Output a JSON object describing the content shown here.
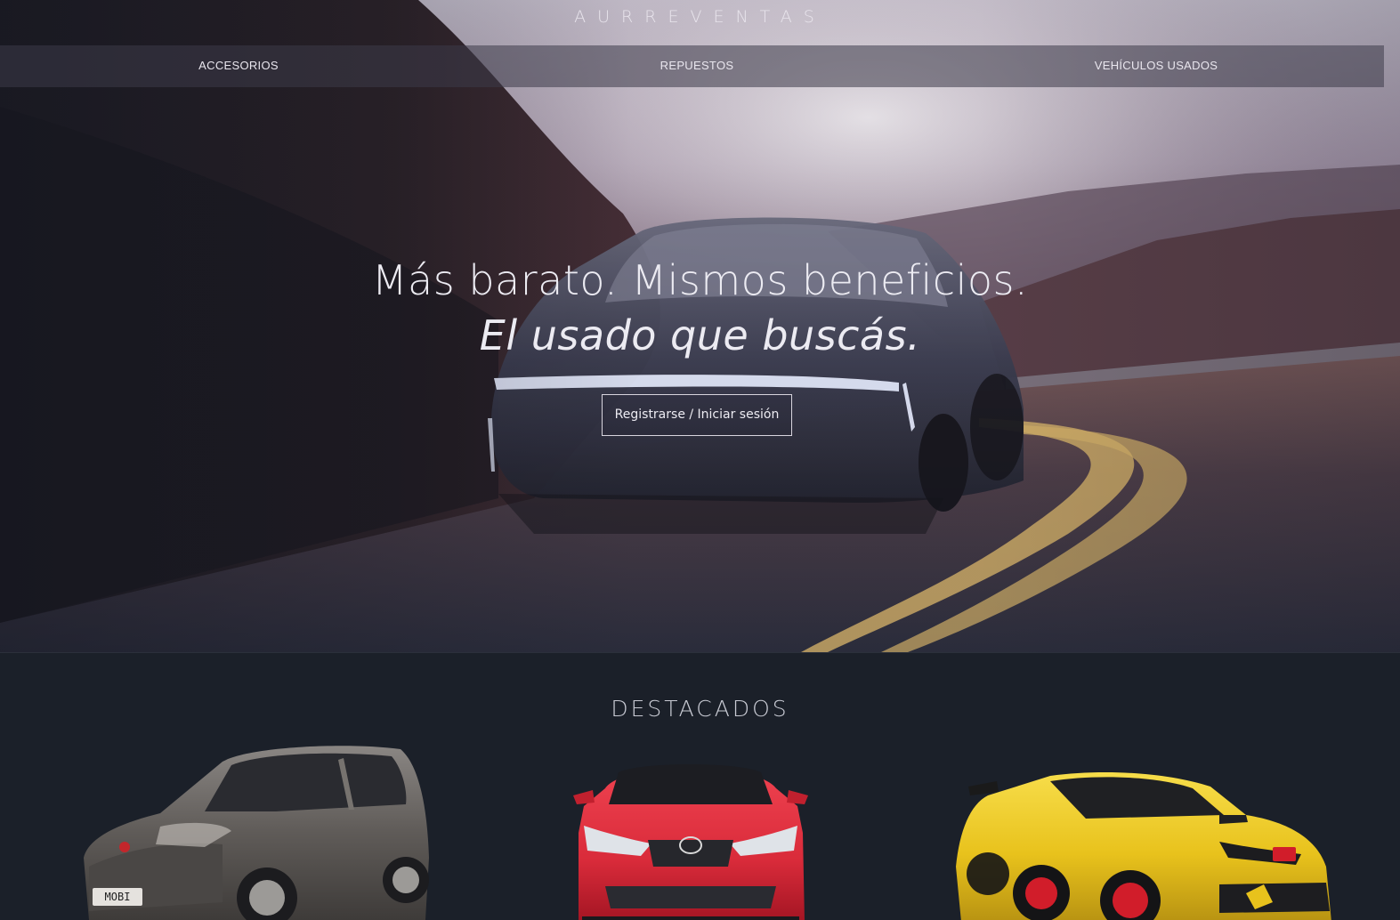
{
  "brand": {
    "logo_text": "AURREVENTAS"
  },
  "nav": {
    "items": [
      {
        "label": "ACCESORIOS"
      },
      {
        "label": "REPUESTOS"
      },
      {
        "label": "VEHÍCULOS USADOS"
      }
    ]
  },
  "hero": {
    "headline_line1": "Más barato. Mismos beneficios.",
    "headline_line2": "El usado que buscás.",
    "cta_label": "Registrarse / Iniciar sesión"
  },
  "featured": {
    "title": "DESTACADOS",
    "cars": [
      {
        "name": "fiat-mobi",
        "color": "#5f5b58",
        "badge": "MOBI"
      },
      {
        "name": "toyota-corolla",
        "color": "#d92b3a"
      },
      {
        "name": "honda-civic-type-r",
        "color": "#e8c21c"
      }
    ]
  },
  "colors": {
    "page_background": "#1b2029",
    "nav_background": "#3c3a48",
    "text_light": "#ecebf2"
  }
}
